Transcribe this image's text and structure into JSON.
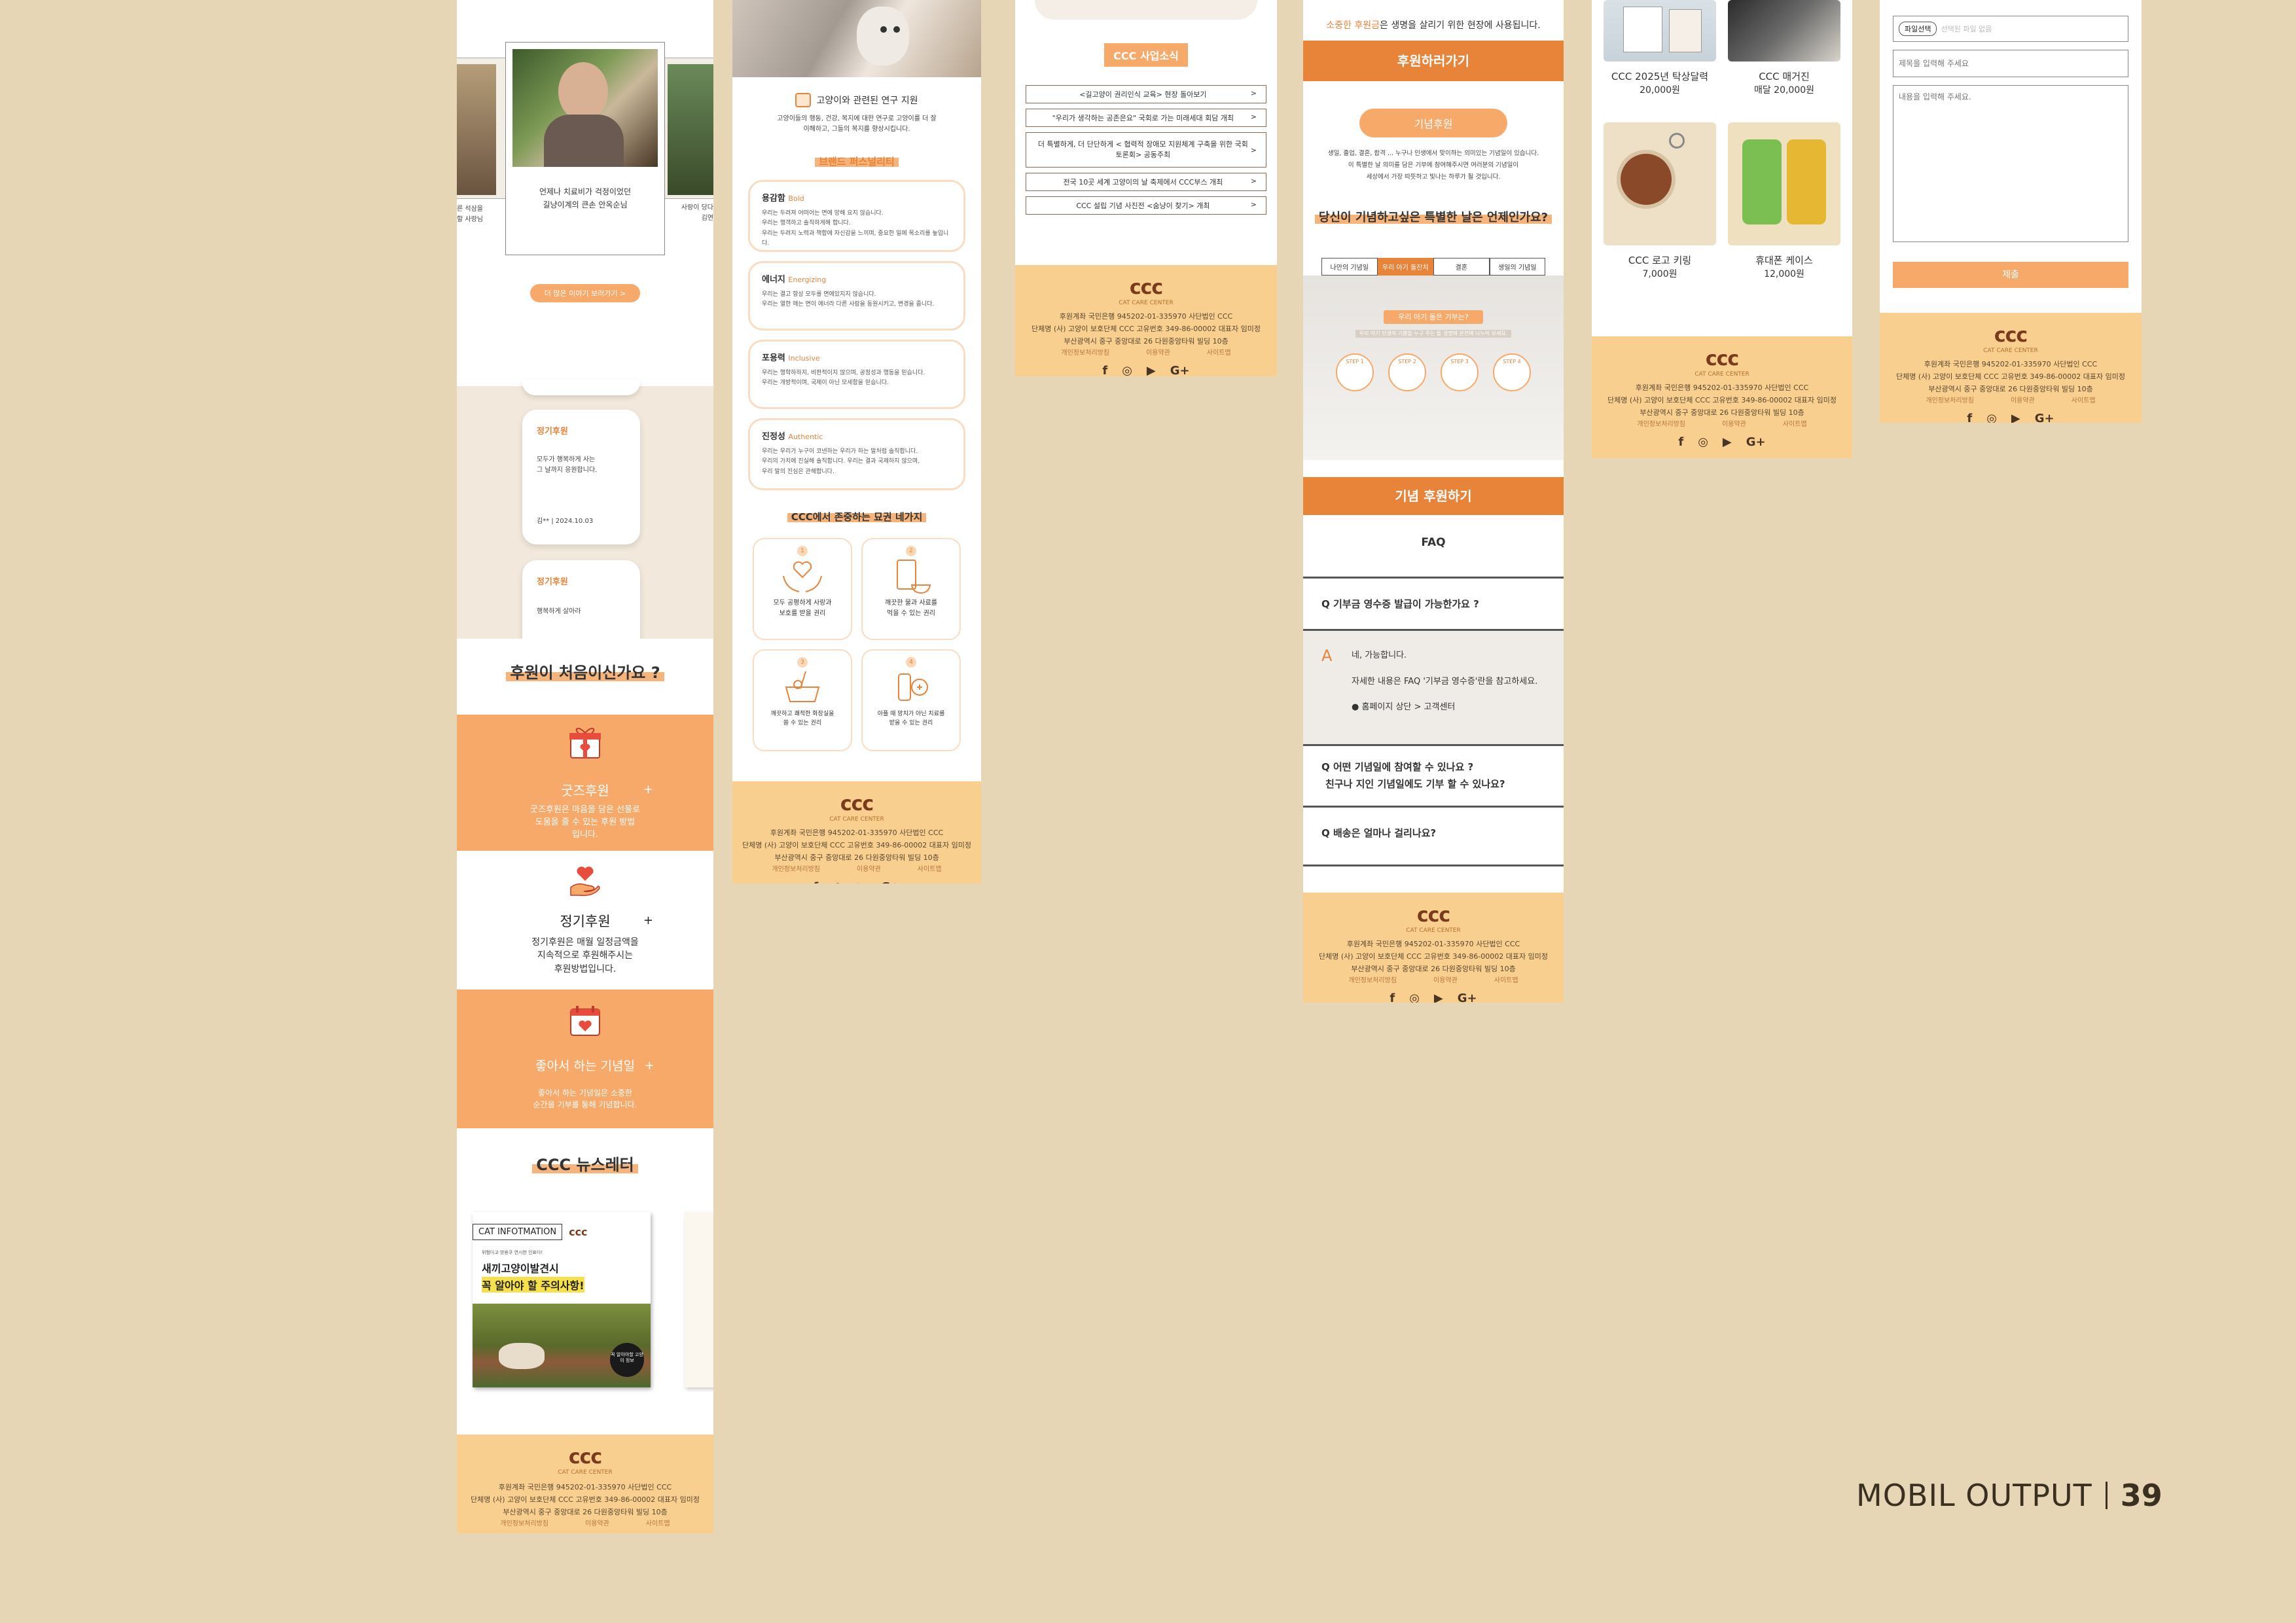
{
  "footer": {
    "logo": "ccc",
    "logo_sub": "CAT CARE CENTER",
    "line1": "후원계좌 국민은행 945202-01-335970 사단법인 CCC",
    "line2": "단체명 (사) 고양이 보호단체 CCC 고유번호 349-86-00002 대표자 임미정",
    "line3": "부산광역시 중구 중앙대로 26 다원중앙타워 빌딩 10층",
    "links": [
      "개인정보처리방침",
      "이용약관",
      "사이트맵"
    ],
    "social": [
      "f",
      "◎",
      "▶",
      "G+"
    ]
  },
  "col1": {
    "story_caption_1": "언제나 치료비가 걱정이었던",
    "story_caption_2": "길냥이계의 큰손 안옥순님",
    "side_left_1": "른 석삼을",
    "side_left_2": "할 사랑님",
    "side_right_1": "사랑이 당다",
    "side_right_2": "김연",
    "story_button": "더 많은 이야기 보러가기 >",
    "review_tag": "정기후원",
    "review_text_1": "모두가 행복하게 사는",
    "review_text_2": "그 날까지 응원합니다.",
    "review_author": "김** | 2024.10.03",
    "review2_tag": "정기후원",
    "review2_text": "행복하게 살아라",
    "first_time_title": "후원이 처음이신가요 ?",
    "goods_title": "굿즈후원",
    "goods_desc_1": "굿즈후원은 마음을 담은 선물로",
    "goods_desc_2": "도움을  줄 수 있는 후원 방법",
    "goods_desc_3": "입니다.",
    "regular_title": "정기후원",
    "regular_desc_1": "정기후원은 매월 일정금액을",
    "regular_desc_2": "지속적으로 후원해주시는",
    "regular_desc_3": "후원방법입니다.",
    "anniv_title": "좋아서 하는 기념일",
    "anniv_desc_1": "좋아서 하는 기념일은 소중한",
    "anniv_desc_2": "순간을 기부를 통해 기념합니다.",
    "plus": "+",
    "newsletter_title": "CCC 뉴스레터",
    "news_header": "CAT INFOTMATION",
    "news_small": "위험다고 방용쿠 연시한 인표다!",
    "news_line1": "새끼고양이발견시",
    "news_line2": "꼭 알아야 할 주의사항!",
    "news_badge": "꼭 알아야할 고양이 정보"
  },
  "col2": {
    "research_title": "고양이와 관련된 연구 지원",
    "research_desc_1": "고양이들의 행동, 건강, 복지에 대한 연구로 고양이를 더 잘",
    "research_desc_2": "이해하고, 그들의 복지를 향상시킵니다.",
    "personality_title": "브랜드 퍼스널리티",
    "cards": [
      {
        "ko": "용감함",
        "en": "Bold",
        "l1": "우리는 두려져 어떠어는 면에 망해 요지 않습니다.",
        "l2": "우리는 행객하고 솔직하게해 합니다.",
        "l3": "우리는 두려지 노력과 책합에 자신감을 느끼며, 중요한 일에 목소리를 높입니다."
      },
      {
        "ko": "에너지",
        "en": "Energizing",
        "l1": "우리는 결고 항상 모두를 면에있지지 않습니다.",
        "l2": "우리는 열한 매는 면이 에너라 다른 사람을 동원시키고, 변경을 줍니다.",
        "l3": ""
      },
      {
        "ko": "포용력",
        "en": "Inclusive",
        "l1": "우리는 행학하하지, 비판적이지 않으며, 공정성과 행동을 믿습니다.",
        "l2": "우리는 개방적이며, 국제이 아닌 모세함을 믿습니다.",
        "l3": ""
      },
      {
        "ko": "진정성",
        "en": "Authentic",
        "l1": "우리는 우리가 누구이 코넨하는 우리가 하는 말처럼 솔직합니다.",
        "l2": "우리의 가치에 진실해 솔직합니다. 우리는 결과 국제하지 않으며,",
        "l3": "우리 말의 진심은 관해합니다."
      }
    ],
    "values_title": "CCC에서 존중하는 묘권 네가지",
    "values": [
      {
        "n": "1",
        "l1": "모두 공평하게 사랑과",
        "l2": "보호를 받을 권리"
      },
      {
        "n": "2",
        "l1": "깨끗한 물과 사료를",
        "l2": "먹을 수 있는 권리"
      },
      {
        "n": "3",
        "l1": "깨끗하고 쾌적한 화장실을",
        "l2": "쓸 수 있는 권리"
      },
      {
        "n": "4",
        "l1": "아플 때 망치가 아닌 치료를",
        "l2": "받을 수 있는 권리"
      }
    ]
  },
  "col3": {
    "title": "CCC 사업소식",
    "items": [
      "<길고양이 권리인식 교육> 현장 돌아보기",
      "\"우리가 생각하는 공존은요\" 국회로 가는 미래세대 회담 개최",
      "더 특별하게, 더 단단하게 < 협력적 장애모 지원체계 구축을 위한 국회 토론회> 공동주최",
      "전국 10곳 세계 고양이의 날 축제에서 CCC부스 개최",
      "CCC 설립 기념 사진전 <숨냥이 찾기> 개최"
    ]
  },
  "col4": {
    "top_text_hl": "소중한 후원금",
    "top_text": "은 생명을 살리기 위한 현장에 사용됩니다.",
    "donate_bar": "후원하러가기",
    "memorial_btn": "기념후원",
    "memorial_desc_1": "생일, 졸업, 결혼, 합격 ... 누구나 인생에서 맞이하는 의미있는 기념일이 있습니다.",
    "memorial_desc_2": "이 특별한 날 의미를 담은 기부에 참여해주시면 여러분의 기념일이",
    "memorial_desc_3": "세상에서 가장 따뜻하고 빛나는 하루가 될 것입니다.",
    "question": "당신이 기념하고싶은 특별한 날은 언제인가요?",
    "tabs": [
      "나만의 기념일",
      "우리 아기 돌잔치",
      "결혼",
      "생일의 기념일"
    ],
    "steps_title": "우리 아기 돌은 기부는?",
    "steps_desc": "우리 아기 탄생의 기쁨을 누구 주는 돌 생명에 온전에 나누어 보세요.",
    "steps": [
      "STEP 1",
      "STEP 2",
      "STEP 3",
      "STEP 4"
    ],
    "memorial_bar": "기념 후원하기",
    "faq_title": "FAQ",
    "faq1": "Q 기부금 영수증 발급이 가능한가요 ?",
    "answer_a": "A",
    "answer_1": "네, 가능합니다.",
    "answer_2": "자세한 내용은 FAQ '기부금 영수증'란을 참고하세요.",
    "answer_3": "● 홈페이지 상단 > 고객센터",
    "faq2_1": "Q 어떤 기념일에 참여할 수 있나요 ?",
    "faq2_2": "친구나 지인 기념일에도 기부 할 수 있나요?",
    "faq3": "Q 배송은 얼마나 걸리나요?"
  },
  "col5": {
    "products": [
      {
        "name": "CCC 2025년 탁상달력",
        "price": "20,000원"
      },
      {
        "name": "CCC 매거진",
        "price": "매달 20,000원"
      },
      {
        "name": "CCC 로고 키링",
        "price": "7,000원"
      },
      {
        "name": "휴대폰 케이스",
        "price": "12,000원"
      }
    ]
  },
  "col6": {
    "file_btn": "파일선택",
    "file_placeholder": "선택된 파일 없음",
    "title_placeholder": "제목을 입력해 주세요",
    "content_placeholder": "내용을 입력해 주세요.",
    "submit": "제출"
  },
  "page_label": "MOBIL OUTPUT",
  "page_number": "39"
}
